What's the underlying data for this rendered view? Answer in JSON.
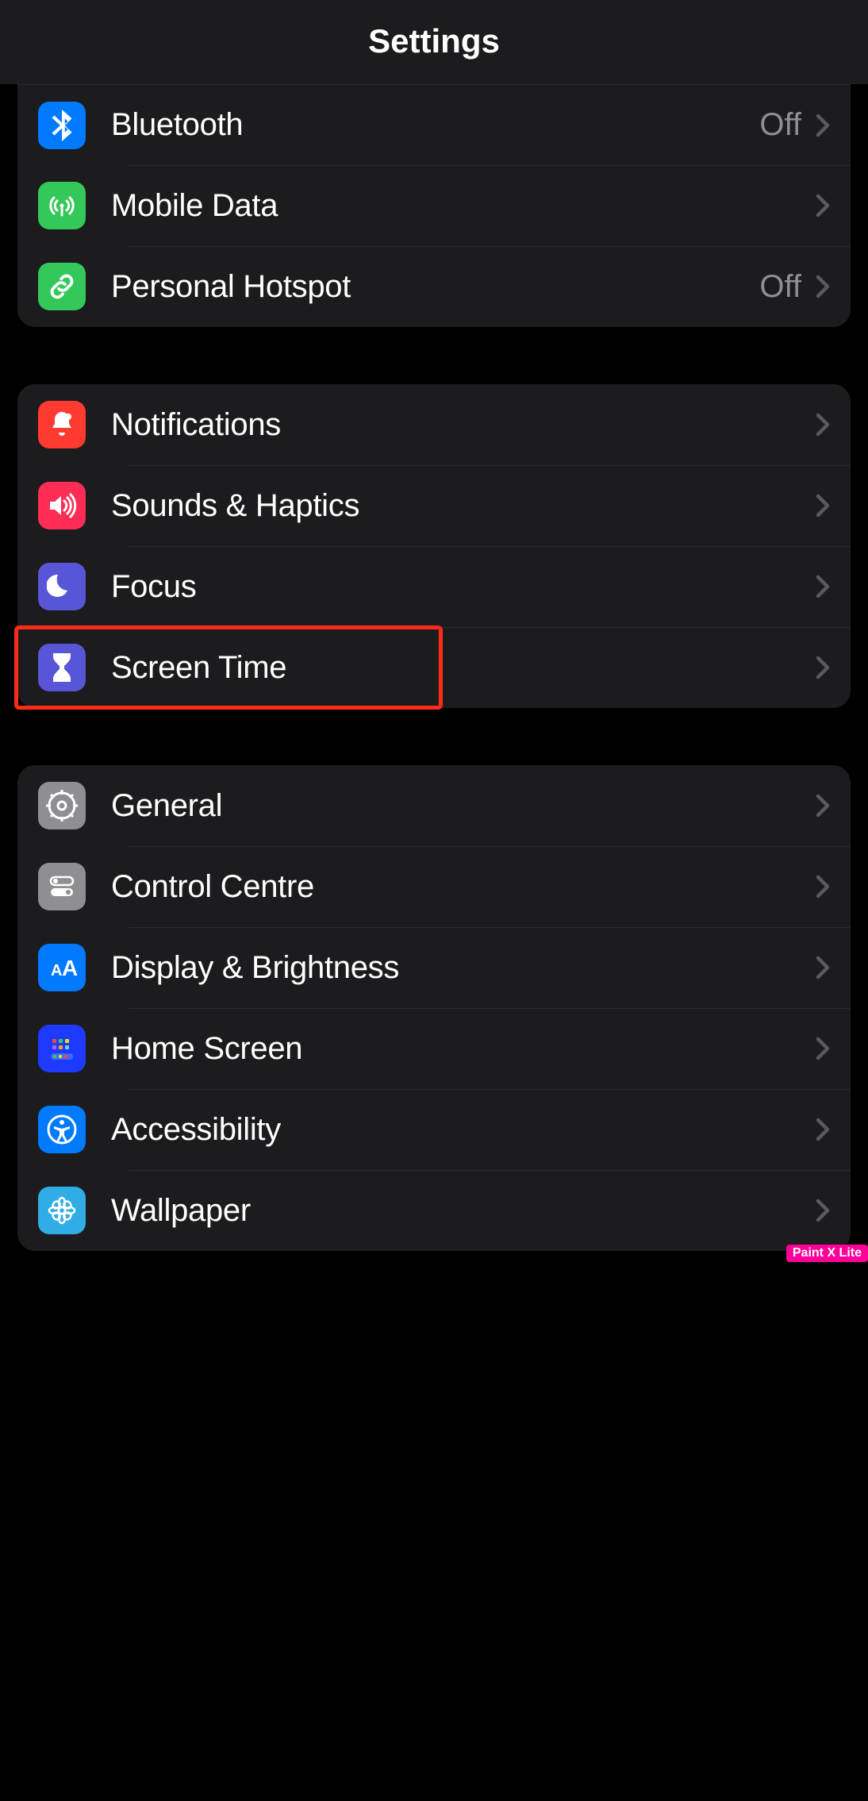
{
  "header": {
    "title": "Settings"
  },
  "groups": [
    {
      "id": "connectivity",
      "rows": [
        {
          "id": "bluetooth",
          "label": "Bluetooth",
          "value": "Off",
          "icon": "bluetooth-icon",
          "bg": "bg-blue"
        },
        {
          "id": "mobile-data",
          "label": "Mobile Data",
          "value": null,
          "icon": "antenna-icon",
          "bg": "bg-green"
        },
        {
          "id": "personal-hotspot",
          "label": "Personal Hotspot",
          "value": "Off",
          "icon": "link-icon",
          "bg": "bg-green"
        }
      ]
    },
    {
      "id": "attention",
      "rows": [
        {
          "id": "notifications",
          "label": "Notifications",
          "value": null,
          "icon": "bell-icon",
          "bg": "bg-red"
        },
        {
          "id": "sounds-haptics",
          "label": "Sounds & Haptics",
          "value": null,
          "icon": "speaker-icon",
          "bg": "bg-pink"
        },
        {
          "id": "focus",
          "label": "Focus",
          "value": null,
          "icon": "moon-icon",
          "bg": "bg-indigo"
        },
        {
          "id": "screen-time",
          "label": "Screen Time",
          "value": null,
          "icon": "hourglass-icon",
          "bg": "bg-indigo",
          "highlighted": true
        }
      ]
    },
    {
      "id": "system",
      "rows": [
        {
          "id": "general",
          "label": "General",
          "value": null,
          "icon": "gear-icon",
          "bg": "bg-grey"
        },
        {
          "id": "control-centre",
          "label": "Control Centre",
          "value": null,
          "icon": "toggles-icon",
          "bg": "bg-grey"
        },
        {
          "id": "display-brightness",
          "label": "Display & Brightness",
          "value": null,
          "icon": "textsize-icon",
          "bg": "bg-blue"
        },
        {
          "id": "home-screen",
          "label": "Home Screen",
          "value": null,
          "icon": "appgrid-icon",
          "bg": "bg-darkblue"
        },
        {
          "id": "accessibility",
          "label": "Accessibility",
          "value": null,
          "icon": "accessibility-icon",
          "bg": "bg-blue"
        },
        {
          "id": "wallpaper",
          "label": "Wallpaper",
          "value": null,
          "icon": "flower-icon",
          "bg": "bg-cyan"
        }
      ]
    }
  ],
  "annotation": {
    "highlight_target": "screen-time",
    "watermark": "Paint X Lite"
  }
}
